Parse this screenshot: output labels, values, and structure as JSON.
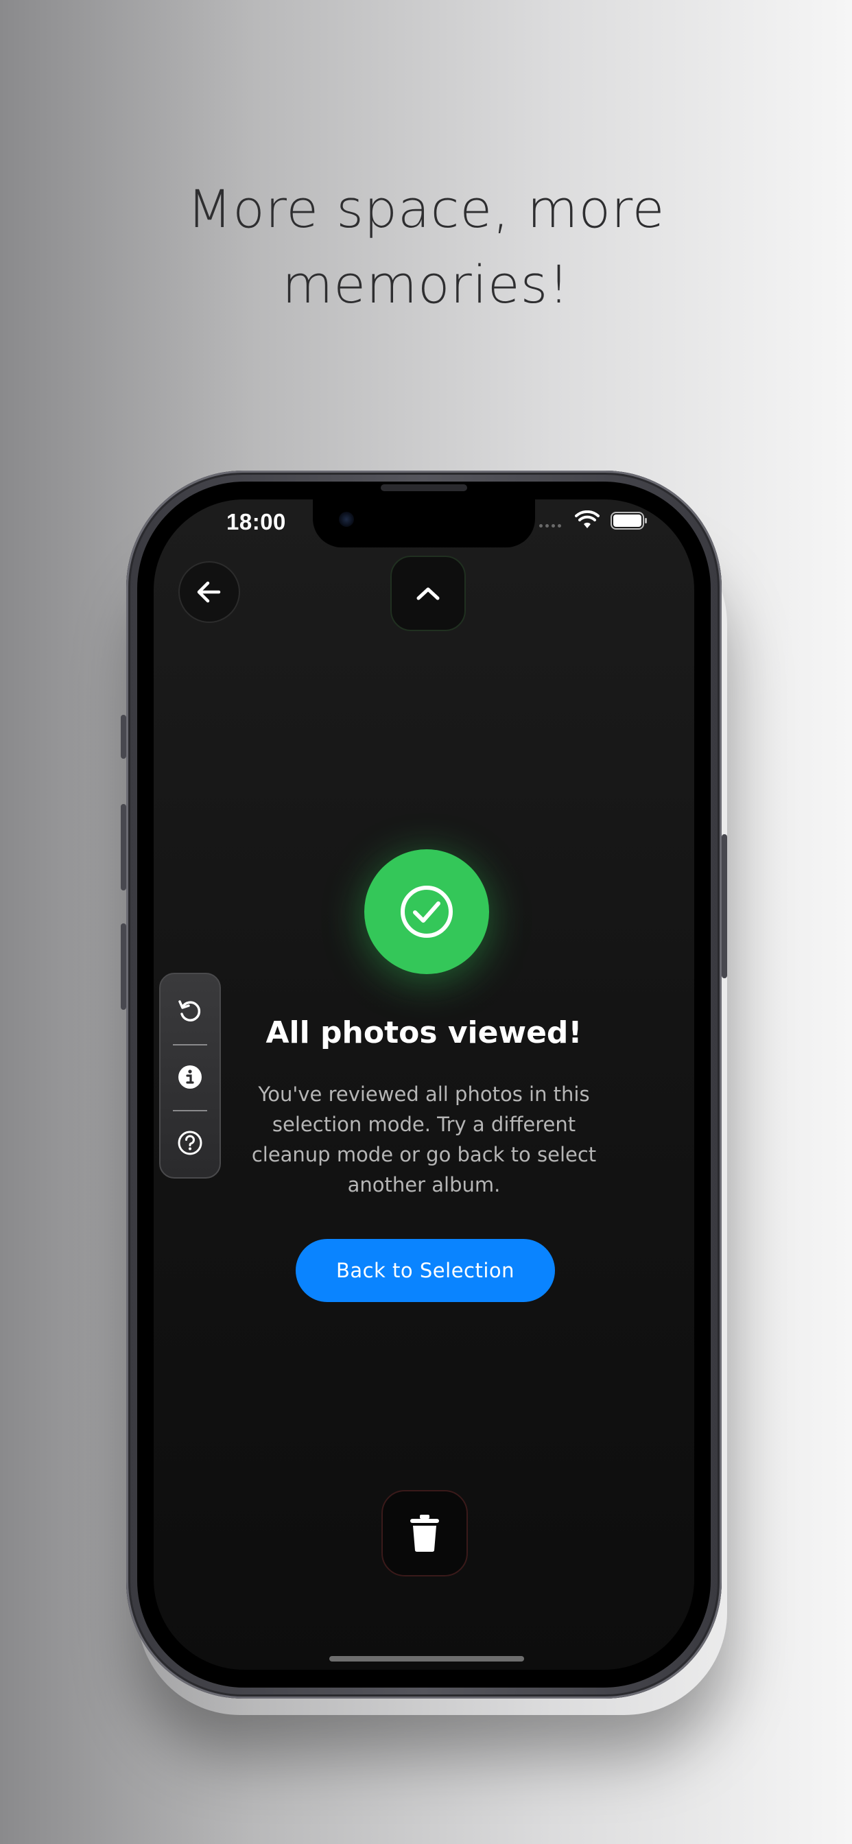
{
  "headline": {
    "line1": "More space, more",
    "line2": "memories!"
  },
  "status_bar": {
    "time": "18:00",
    "icons": [
      "wifi-icon",
      "battery-icon"
    ]
  },
  "nav": {
    "back_icon": "arrow-left-icon",
    "collapse_icon": "chevron-up-icon"
  },
  "side_toolbar": {
    "items": [
      {
        "icon": "undo-icon"
      },
      {
        "icon": "info-icon"
      },
      {
        "icon": "help-icon"
      }
    ]
  },
  "empty_state": {
    "icon": "checkmark-circle-icon",
    "title": "All photos viewed!",
    "message": "You've reviewed all photos in this selection mode. Try a different cleanup mode or go back to select another album.",
    "button_label": "Back to Selection"
  },
  "bottom": {
    "delete_icon": "trash-icon"
  },
  "colors": {
    "success": "#34c759",
    "primary": "#0a84ff",
    "background": "#141414"
  }
}
